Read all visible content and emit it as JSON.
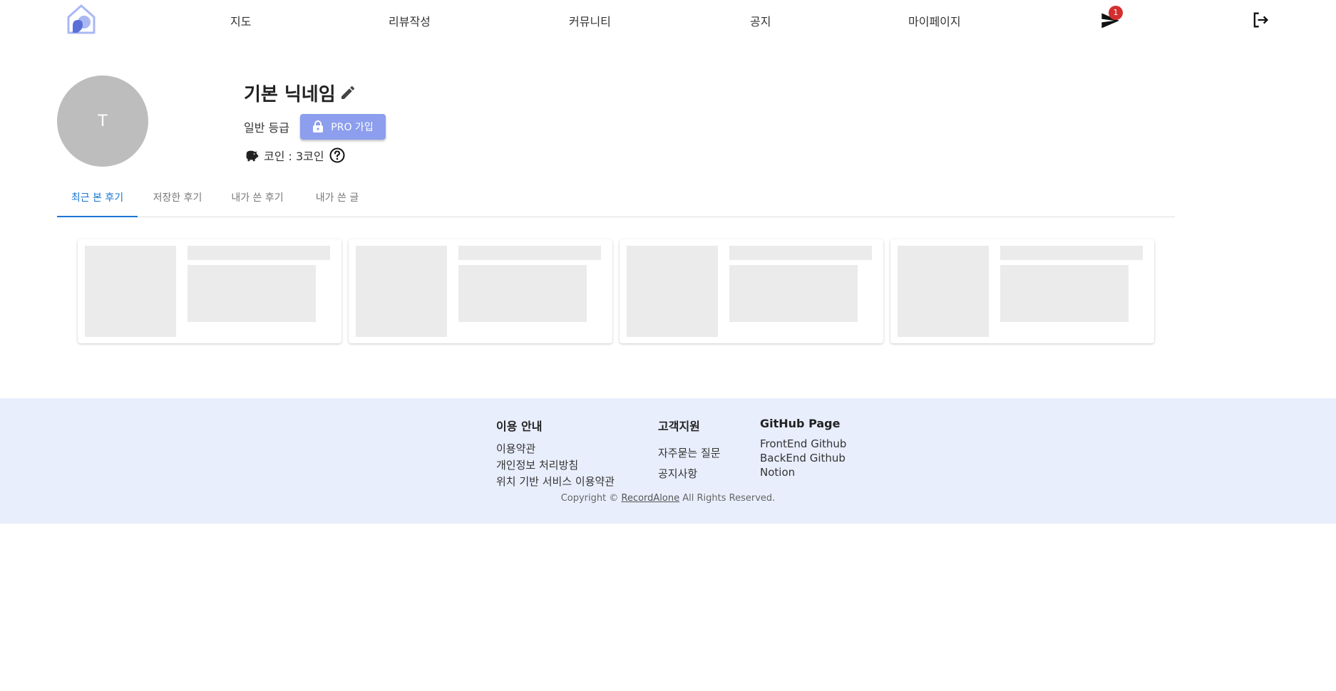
{
  "nav": {
    "logo_icon": "home-logo-icon",
    "items": [
      {
        "label": "지도"
      },
      {
        "label": "리뷰작성"
      },
      {
        "label": "커뮤니티"
      },
      {
        "label": "공지"
      },
      {
        "label": "마이페이지"
      }
    ],
    "message_icon": "send-icon",
    "message_badge": "1",
    "logout_icon": "logout-icon"
  },
  "profile": {
    "avatar_letter": "T",
    "nickname": "기본 닉네임",
    "edit_icon": "pencil-icon",
    "grade": "일반 등급",
    "pro_button": "PRO 가입",
    "pro_icon": "lock-icon",
    "coin_label": "코인 : 3코인",
    "coin_icon": "piggy-bank-icon",
    "help_icon": "help-circle-icon"
  },
  "tabs": [
    {
      "label": "최근 본 후기",
      "active": true
    },
    {
      "label": "저장한 후기",
      "active": false
    },
    {
      "label": "내가 쓴 후기",
      "active": false
    },
    {
      "label": "내가 쓴 글",
      "active": false
    }
  ],
  "footer": {
    "guide": {
      "title": "이용 안내",
      "links": [
        "이용약관",
        "개인정보 처리방침",
        "위치 기반 서비스 이용약관"
      ]
    },
    "support": {
      "title": "고객지원",
      "links": [
        "자주묻는 질문",
        "공지사항"
      ]
    },
    "github": {
      "title": "GitHub Page",
      "links": [
        "FrontEnd Github",
        "BackEnd Github",
        "Notion"
      ]
    },
    "copyright_prefix": "Copyright ©",
    "copyright_brand": "RecordAlone",
    "copyright_suffix": "All Rights Reserved."
  },
  "colors": {
    "accent": "#1976d2",
    "pro_button": "#8c9eed",
    "badge": "#d32f2f",
    "footer_bg": "#e8eefc",
    "skeleton": "#ebebeb"
  }
}
